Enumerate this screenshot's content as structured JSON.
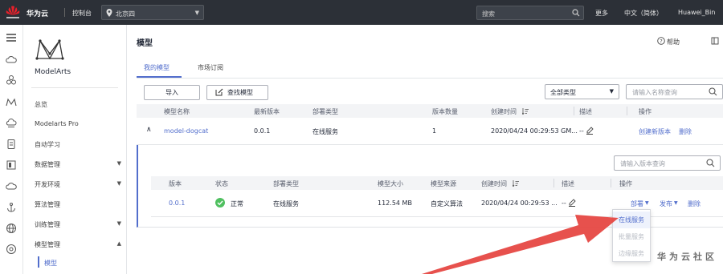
{
  "topbar": {
    "logo_text": "华为云",
    "console": "控制台",
    "region": "北京四",
    "search_placeholder": "搜索",
    "more": "更多",
    "language": "中文（简体）",
    "user": "Huawei_Bin"
  },
  "sidebar": {
    "brand": "ModelArts",
    "items": [
      {
        "label": "总览",
        "has_arrow": false
      },
      {
        "label": "Modelarts Pro",
        "has_arrow": false
      },
      {
        "label": "自动学习",
        "has_arrow": false
      },
      {
        "label": "数据管理",
        "has_arrow": true
      },
      {
        "label": "开发环境",
        "has_arrow": true
      },
      {
        "label": "算法管理",
        "has_arrow": false
      },
      {
        "label": "训练管理",
        "has_arrow": true
      },
      {
        "label": "模型管理",
        "has_arrow": true
      }
    ],
    "sub_active": "模型"
  },
  "main": {
    "title": "模型",
    "help": "帮助",
    "tabs": [
      {
        "label": "我的模型",
        "active": true
      },
      {
        "label": "市场订阅",
        "active": false
      }
    ],
    "import_label": "导入",
    "find_label": "查找模型",
    "type_select": "全部类型",
    "name_search_placeholder": "请输入名称查询",
    "version_search_placeholder": "请输入版本查询"
  },
  "table": {
    "headers": [
      "模型名称",
      "最新版本",
      "部署类型",
      "版本数量",
      "创建时间",
      "描述",
      "操作"
    ],
    "row": {
      "name": "model-dogcat",
      "version": "0.0.1",
      "deploy": "在线服务",
      "count": "1",
      "created": "2020/04/24 00:29:53 GM...",
      "desc": "--",
      "action_create": "创建新版本",
      "action_delete": "删除"
    }
  },
  "inner_table": {
    "headers": [
      "版本",
      "状态",
      "部署类型",
      "模型大小",
      "模型来源",
      "创建时间",
      "描述",
      "操作"
    ],
    "row": {
      "version": "0.0.1",
      "status": "正常",
      "deploy": "在线服务",
      "size": "112.54 MB",
      "source": "自定义算法",
      "created": "2020/04/24 00:29:53 ...",
      "desc": "--",
      "deploy_action": "部署",
      "publish_action": "发布",
      "delete_action": "删除"
    }
  },
  "dropdown": {
    "items": [
      "在线服务",
      "批量服务",
      "边缘服务"
    ]
  },
  "watermark": "华为云社区",
  "colors": {
    "accent": "#526ecc",
    "success": "#50c060",
    "arrow": "#e5423e",
    "topbar": "#2c3037"
  }
}
